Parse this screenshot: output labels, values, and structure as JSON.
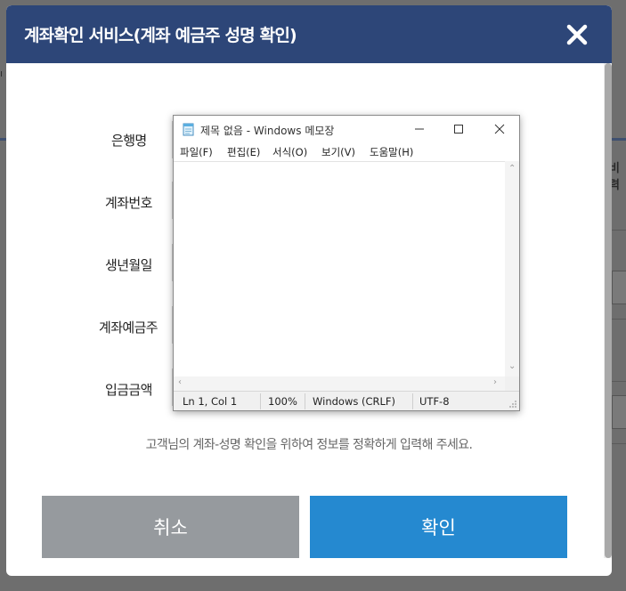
{
  "dialog": {
    "title": "계좌확인 서비스(계좌 예금주 성명 확인)",
    "close_icon": "close-x-icon",
    "fields": [
      {
        "label": "은행명"
      },
      {
        "label": "계좌번호"
      },
      {
        "label": "생년월일"
      },
      {
        "label": "계좌예금주"
      },
      {
        "label": "입금금액"
      }
    ],
    "notice": "고객님의 계좌-성명 확인을 위하여 정보를 정확하게 입력해 주세요.",
    "cancel_label": "취소",
    "confirm_label": "확인",
    "colors": {
      "header": "#2d4678",
      "cancel": "#969a9e",
      "confirm": "#2589d0"
    }
  },
  "notepad": {
    "title": "제목 없음 - Windows 메모장",
    "app_icon": "notepad-icon",
    "menu": [
      "파일(F)",
      "편집(E)",
      "서식(O)",
      "보기(V)",
      "도움말(H)"
    ],
    "content": "",
    "status": {
      "position": "Ln 1, Col 1",
      "zoom": "100%",
      "line_ending": "Windows (CRLF)",
      "encoding": "UTF-8"
    }
  },
  "background": {
    "right_fragment": "비력"
  }
}
